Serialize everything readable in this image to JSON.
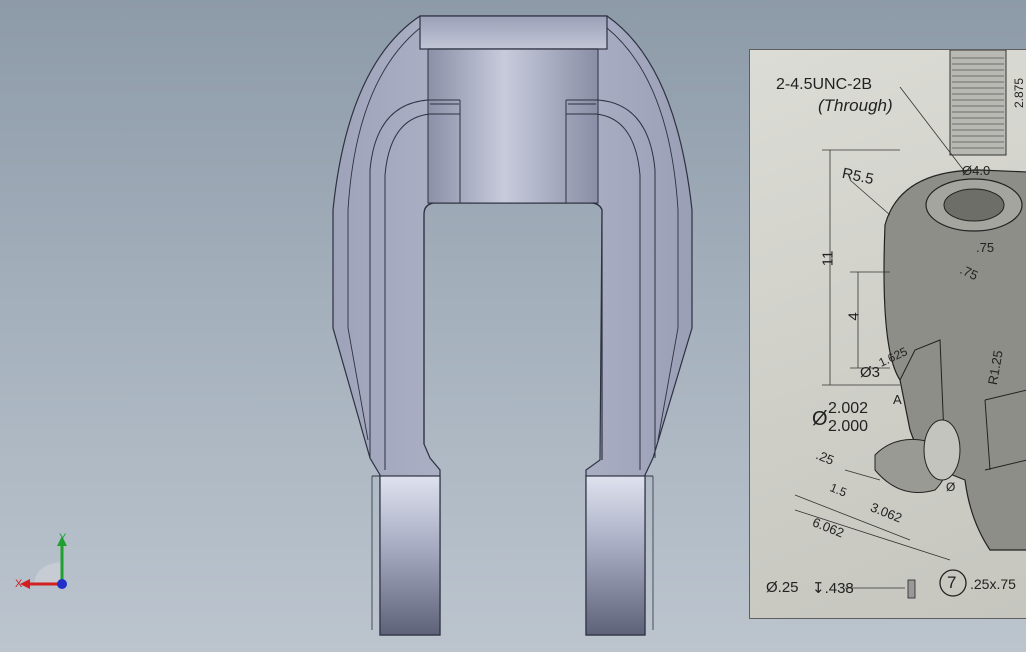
{
  "viewport": {
    "background_top": "#8d9aa8",
    "background_bottom": "#bcc5ce",
    "part_face_color": "#a9aec4",
    "part_edge_color": "#2e3140"
  },
  "reference_image": {
    "callouts": {
      "thread": "2-4.5UNC-2B",
      "through": "(Through)",
      "dim_2875": "2.875",
      "radius_55": "R5.5",
      "dia_4": "Ø4.0",
      "height_11": "11",
      "dim_75a": ".75",
      "dim_75b": ".75",
      "height_4": "4",
      "r_125": "R1.25",
      "dia_3": "Ø3",
      "dim_1625": "1.625",
      "label_a": "A",
      "dia_symbol": "Ø",
      "dia_upper": "2.002",
      "dia_lower": "2.000",
      "dim_25": ".25",
      "dim_15": "1.5",
      "dim_3062": "3.062",
      "dim_6062": "6.062",
      "dim_dia_small": "Ø",
      "hole_note": "Ø.25",
      "depth_note": "↧.438",
      "balloon": "7",
      "chamfer": ".25x.75"
    }
  },
  "triad": {
    "x_label": "X",
    "y_label": "Y",
    "x_color": "#d22020",
    "y_color": "#1fa030",
    "z_color": "#2030c8"
  }
}
